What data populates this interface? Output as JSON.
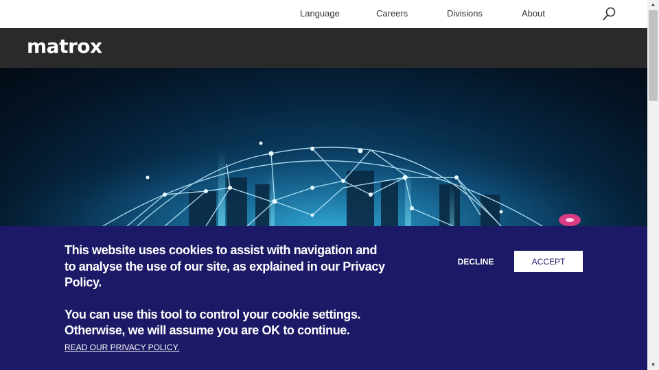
{
  "topnav": {
    "items": [
      {
        "label": "Language"
      },
      {
        "label": "Careers"
      },
      {
        "label": "Divisions"
      },
      {
        "label": "About"
      }
    ],
    "search_icon": "search-icon"
  },
  "brand": {
    "logo_text": "matrox"
  },
  "cookie_banner": {
    "message_1": "This website uses cookies to assist with navigation and to analyse the use of our site, as explained in our Privacy Policy.",
    "message_2": "You can use this tool to control your cookie settings. Otherwise, we will assume you are OK to continue.",
    "privacy_link": "READ OUR PRIVACY POLICY.",
    "decline_label": "DECLINE",
    "accept_label": "ACCEPT",
    "background_color": "#1c1a66"
  },
  "colors": {
    "brandbar": "#2a2a2a",
    "accent_navy": "#1c1a66"
  },
  "scrollbar": {
    "up_icon": "up-arrow-icon",
    "down_icon": "down-arrow-icon"
  }
}
